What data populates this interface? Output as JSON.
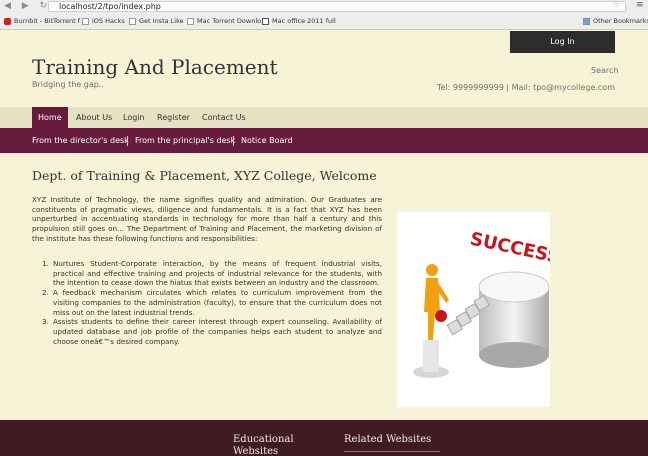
{
  "browser": {
    "url": "localhost/2/tpo/index.php",
    "bookmarks": [
      {
        "label": "Burnbit - BitTorrent f",
        "icon": "youtube-icon"
      },
      {
        "label": "iOS Hacks",
        "icon": "page-icon"
      },
      {
        "label": "Get Insta Like",
        "icon": "page-icon"
      },
      {
        "label": "Mac Torrent Downlo",
        "icon": "page-icon"
      },
      {
        "label": "Mac office 2011 full",
        "icon": "document-icon"
      }
    ],
    "other_bookmarks": "Other Bookmarks"
  },
  "header": {
    "login_tab": "Log In",
    "title": "Training And Placement",
    "tagline": "Bridging the gap..",
    "search": "Search",
    "contact": "Tel: 9999999999 | Mail: tpo@mycollege.com"
  },
  "nav": {
    "items": [
      "Home",
      "About Us",
      "Login",
      "Register",
      "Contact Us"
    ],
    "active": "Home"
  },
  "subnav": {
    "items": [
      "From the director's desk",
      "From the principal's desk",
      "Notice Board"
    ]
  },
  "main": {
    "heading": "Dept. of Training & Placement, XYZ College, Welcome",
    "intro": "XYZ Institute of Technology, the name signifies quality and admiration. Our Graduates are constituents of pragmatic views, diligence and fundamentals. It is a fact that XYZ has been unperturbed in accentuating standards in technology for more than half a century and this propulsion still goes on... The Department of Training and Placement, the marketing division of the institute has these following functions and responsibilities:",
    "list": [
      "Nurtures Student-Corporate interaction, by the means of frequent industrial visits, practical and effective training and projects of industrial relevance for the students, with the intention to cease down the hiatus that exists between an industry and the classroom.",
      "A feedback mechanism circulates which relates to curriculum improvement from the visiting companies to the administration (faculty), to ensure that the curriculum does not miss out on the latest industrial trends.",
      "Assists students to define their career interest through expert counseling. Availability of updated database and job profile of the companies helps each student to analyze and choose oneâ€™s desired company."
    ],
    "image_text": "SUCCESS"
  },
  "footer": {
    "col1": "Educational Websites",
    "col2": "Related Websites"
  },
  "colors": {
    "background": "#f7f3d6",
    "nav_bar": "#e5e1c3",
    "accent": "#671c3d",
    "footer": "#401c22",
    "login_tab": "#2d2d2d"
  }
}
